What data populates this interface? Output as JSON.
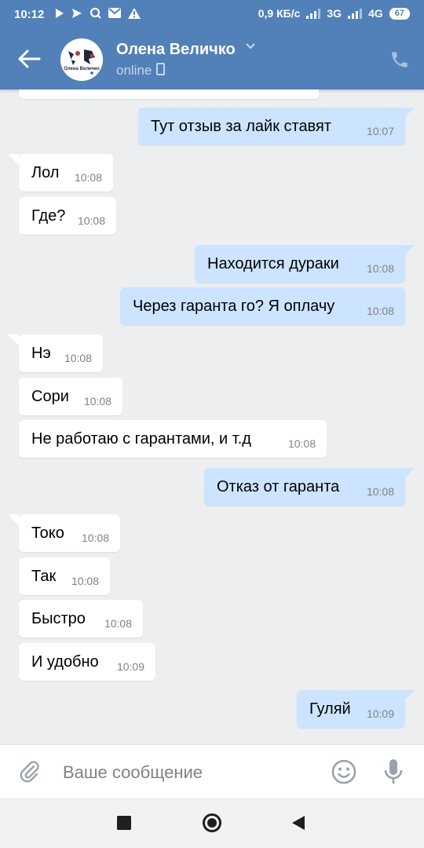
{
  "status_bar": {
    "time": "10:12",
    "net_speed": "0,9 КБ/с",
    "net1": "3G",
    "net2": "4G",
    "battery": "67"
  },
  "header": {
    "name": "Олена Величко",
    "status": "online",
    "avatar_text": "Олена Величко"
  },
  "messages": [
    {
      "dir": "out",
      "text": "Тут отзыв за лайк ставят",
      "time": "10:07"
    },
    {
      "dir": "in",
      "text": "Лол",
      "time": "10:08"
    },
    {
      "dir": "in",
      "text": "Где?",
      "time": "10:08"
    },
    {
      "dir": "out",
      "text": "Находится дураки",
      "time": "10:08"
    },
    {
      "dir": "out",
      "text": "Через гаранта го? Я оплачу",
      "time": "10:08"
    },
    {
      "dir": "in",
      "text": "Нэ",
      "time": "10:08"
    },
    {
      "dir": "in",
      "text": "Сори",
      "time": "10:08"
    },
    {
      "dir": "in",
      "text": "Не работаю с гарантами, и т.д",
      "time": "10:08"
    },
    {
      "dir": "out",
      "text": "Отказ от гаранта",
      "time": "10:08"
    },
    {
      "dir": "in",
      "text": "Токо",
      "time": "10:08"
    },
    {
      "dir": "in",
      "text": "Так",
      "time": "10:08"
    },
    {
      "dir": "in",
      "text": "Быстро",
      "time": "10:08"
    },
    {
      "dir": "in",
      "text": "И удобно",
      "time": "10:09"
    },
    {
      "dir": "out",
      "text": "Гуляй",
      "time": "10:09"
    }
  ],
  "composer": {
    "placeholder": "Ваше сообщение"
  },
  "colors": {
    "header_bg": "#5181b8",
    "incoming_bubble": "#ffffff",
    "outgoing_bubble": "#cce4ff",
    "chat_bg": "#edeef0"
  },
  "icons": [
    "back-arrow-icon",
    "phone-icon",
    "paperclip-icon",
    "smile-icon",
    "microphone-icon",
    "square-icon",
    "circle-icon",
    "triangle-back-icon"
  ]
}
